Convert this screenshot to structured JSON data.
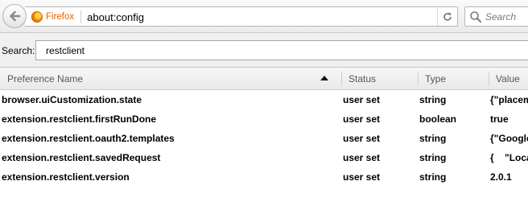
{
  "toolbar": {
    "brand_label": "Firefox",
    "url": "about:config",
    "search_placeholder": "Search"
  },
  "filter": {
    "label": "Search:",
    "value": "restclient"
  },
  "table": {
    "columns": {
      "name": "Preference Name",
      "status": "Status",
      "type": "Type",
      "value": "Value"
    },
    "sort_direction": "ascending",
    "rows": [
      {
        "name": "browser.uiCustomization.state",
        "status": "user set",
        "type": "string",
        "value": "{\"placem"
      },
      {
        "name": "extension.restclient.firstRunDone",
        "status": "user set",
        "type": "boolean",
        "value": "true"
      },
      {
        "name": "extension.restclient.oauth2.templates",
        "status": "user set",
        "type": "string",
        "value": "{\"Google"
      },
      {
        "name": "extension.restclient.savedRequest",
        "status": "user set",
        "type": "string",
        "value": "{    \"Loca"
      },
      {
        "name": "extension.restclient.version",
        "status": "user set",
        "type": "string",
        "value": "2.0.1"
      }
    ]
  },
  "colors": {
    "brand": "#e66000",
    "header_text": "#575757"
  }
}
